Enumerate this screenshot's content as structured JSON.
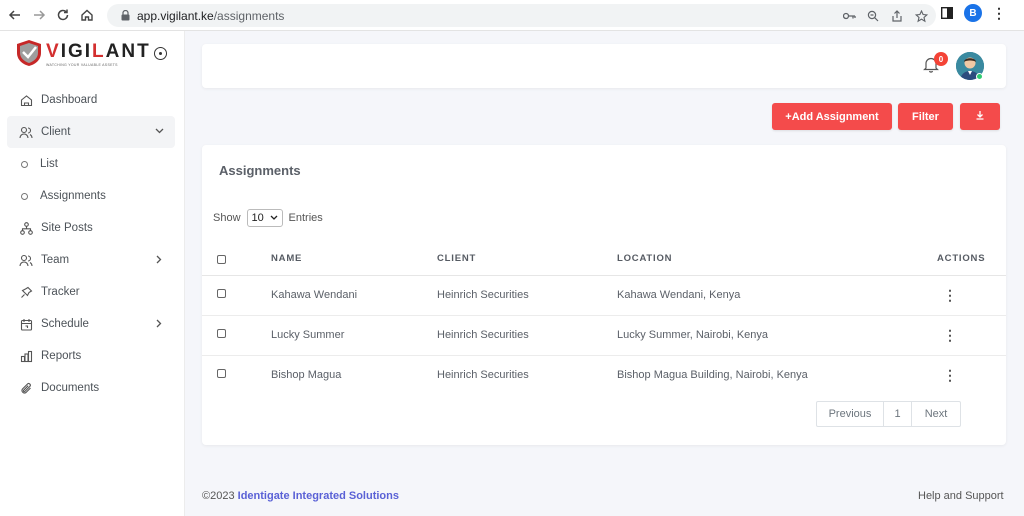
{
  "browser": {
    "url_domain": "app.vigilant.ke",
    "url_path": "/assignments",
    "profile_initial": "B"
  },
  "logo": {
    "text_red_1": "V",
    "text_mid": "IGI",
    "text_red_2": "L",
    "text_end": "ANT",
    "tagline": "WATCHING YOUR VALUABLE ASSETS"
  },
  "sidebar": {
    "items": [
      {
        "label": "Dashboard",
        "icon": "home-icon"
      },
      {
        "label": "Client",
        "icon": "users-icon"
      },
      {
        "label": "List"
      },
      {
        "label": "Assignments"
      },
      {
        "label": "Site Posts",
        "icon": "sitemap-icon"
      },
      {
        "label": "Team",
        "icon": "users-icon"
      },
      {
        "label": "Tracker",
        "icon": "pin-icon"
      },
      {
        "label": "Schedule",
        "icon": "calendar-icon"
      },
      {
        "label": "Reports",
        "icon": "bar-chart-icon"
      },
      {
        "label": "Documents",
        "icon": "paperclip-icon"
      }
    ]
  },
  "topbar": {
    "notification_count": "0"
  },
  "actions": {
    "add_label": "+Add Assignment",
    "filter_label": "Filter"
  },
  "assignments": {
    "title": "Assignments",
    "show_label": "Show",
    "page_size": "10",
    "entries_label": "Entries",
    "columns": [
      "NAME",
      "CLIENT",
      "LOCATION",
      "ACTIONS"
    ],
    "rows": [
      {
        "name": "Kahawa Wendani",
        "client": "Heinrich Securities",
        "location": "Kahawa Wendani, Kenya"
      },
      {
        "name": "Lucky Summer",
        "client": "Heinrich Securities",
        "location": "Lucky Summer, Nairobi, Kenya"
      },
      {
        "name": "Bishop Magua",
        "client": "Heinrich Securities",
        "location": "Bishop Magua Building, Nairobi, Kenya"
      }
    ],
    "pagination": {
      "prev": "Previous",
      "page": "1",
      "next": "Next"
    }
  },
  "footer": {
    "copyright": "©2023 ",
    "company": "Identigate Integrated Solutions",
    "help": "Help and Support"
  },
  "colors": {
    "accent": "#f44b4b",
    "link": "#5a61d6"
  }
}
